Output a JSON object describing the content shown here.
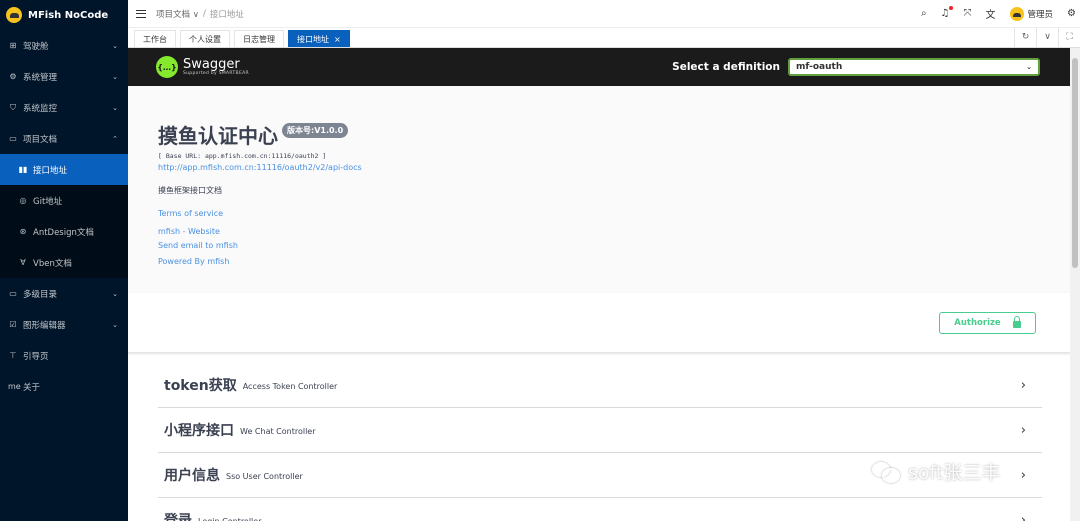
{
  "app": {
    "title": "MFish NoCode"
  },
  "sidebar": {
    "items": [
      {
        "label": "驾驶舱",
        "icon": "grid-icon",
        "glyph": "⊞",
        "chevron": "⌄"
      },
      {
        "label": "系统管理",
        "icon": "gear-icon",
        "glyph": "⚙",
        "chevron": "⌄"
      },
      {
        "label": "系统监控",
        "icon": "monitor-icon",
        "glyph": "⛉",
        "chevron": "⌄"
      },
      {
        "label": "项目文档",
        "icon": "book-icon",
        "glyph": "▭",
        "chevron": "⌃"
      },
      {
        "label": "接口地址",
        "icon": "book-open-icon",
        "glyph": "▮▮",
        "sub": true,
        "active": true
      },
      {
        "label": "Git地址",
        "icon": "github-icon",
        "glyph": "◎",
        "sub": true
      },
      {
        "label": "AntDesign文档",
        "icon": "antdesign-icon",
        "glyph": "⊛",
        "sub": true
      },
      {
        "label": "Vben文档",
        "icon": "vue-icon",
        "glyph": "∀",
        "sub": true
      },
      {
        "label": "多级目录",
        "icon": "folder-icon",
        "glyph": "▭",
        "chevron": "⌄"
      },
      {
        "label": "图形编辑器",
        "icon": "edit-icon",
        "glyph": "☑",
        "chevron": "⌄"
      },
      {
        "label": "引导页",
        "icon": "hammer-icon",
        "glyph": "⊤"
      },
      {
        "label": "关于",
        "icon": "me-icon",
        "glyph": "me"
      }
    ]
  },
  "header": {
    "breadcrumb_parent": "项目文档",
    "breadcrumb_parent_chevron": "∨",
    "breadcrumb_sep": "/",
    "breadcrumb_current": "接口地址",
    "user_name": "管理员",
    "icons": {
      "search": "⌕",
      "bell": "♫",
      "fullscreen": "⤧",
      "translate": "文",
      "settings": "⚙"
    }
  },
  "tabs": {
    "items": [
      {
        "label": "工作台"
      },
      {
        "label": "个人设置"
      },
      {
        "label": "日志管理"
      },
      {
        "label": "接口地址",
        "active": true,
        "close": "×"
      }
    ],
    "tools": {
      "refresh": "↻",
      "dropdown": "∨",
      "expand": "⛶"
    }
  },
  "swagger": {
    "brand": "Swagger",
    "brand_sub": "Supported by SMARTBEAR",
    "logo_glyph": "{…}",
    "select_label": "Select a definition",
    "select_value": "mf-oauth",
    "select_arrow": "⌄",
    "title": "摸鱼认证中心",
    "version": "版本号:V1.0.0",
    "base_url": "[ Base URL: app.mfish.com.cn:11116/oauth2 ]",
    "docs_url": "http://app.mfish.com.cn:11116/oauth2/v2/api-docs",
    "description": "摸鱼框架接口文档",
    "terms": "Terms of service",
    "website": "mfish - Website",
    "email": "Send email to mfish",
    "powered": "Powered By mfish",
    "authorize": "Authorize",
    "operations": [
      {
        "name": "token获取",
        "desc": "Access Token Controller"
      },
      {
        "name": "小程序接口",
        "desc": "We Chat Controller"
      },
      {
        "name": "用户信息",
        "desc": "Sso User Controller"
      },
      {
        "name": "登录",
        "desc": "Login Controller"
      }
    ],
    "chevron": "›"
  },
  "watermark": {
    "text": "soft张三丰"
  },
  "colors": {
    "sidebar_bg": "#001529",
    "primary": "#0960bd",
    "swagger_green": "#85ea2d",
    "authorize_green": "#49cc90",
    "link": "#4990e2"
  }
}
